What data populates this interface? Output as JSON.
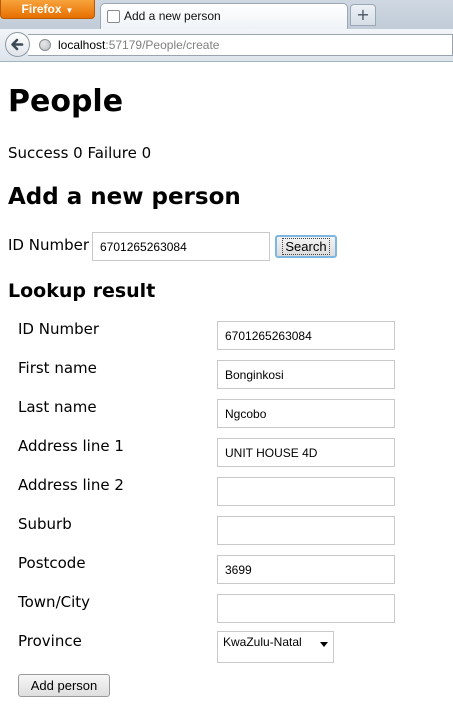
{
  "browser": {
    "app_button": "Firefox",
    "tab_title": "Add a new person",
    "new_tab": "+",
    "url_host": "localhost",
    "url_path": ":57179/People/create"
  },
  "page": {
    "title": "People",
    "stats": "Success 0 Failure 0",
    "add_heading": "Add a new person",
    "id_label": "ID Number",
    "id_value": "6701265263084",
    "search_label": "Search",
    "result_heading": "Lookup result",
    "fields": [
      {
        "label": "ID Number",
        "value": "6701265263084"
      },
      {
        "label": "First name",
        "value": "Bonginkosi"
      },
      {
        "label": "Last name",
        "value": "Ngcobo"
      },
      {
        "label": "Address line 1",
        "value": "UNIT HOUSE 4D"
      },
      {
        "label": "Address line 2",
        "value": ""
      },
      {
        "label": "Suburb",
        "value": ""
      },
      {
        "label": "Postcode",
        "value": "3699"
      },
      {
        "label": "Town/City",
        "value": ""
      }
    ],
    "province_label": "Province",
    "province_value": "KwaZulu-Natal",
    "add_button": "Add person"
  }
}
